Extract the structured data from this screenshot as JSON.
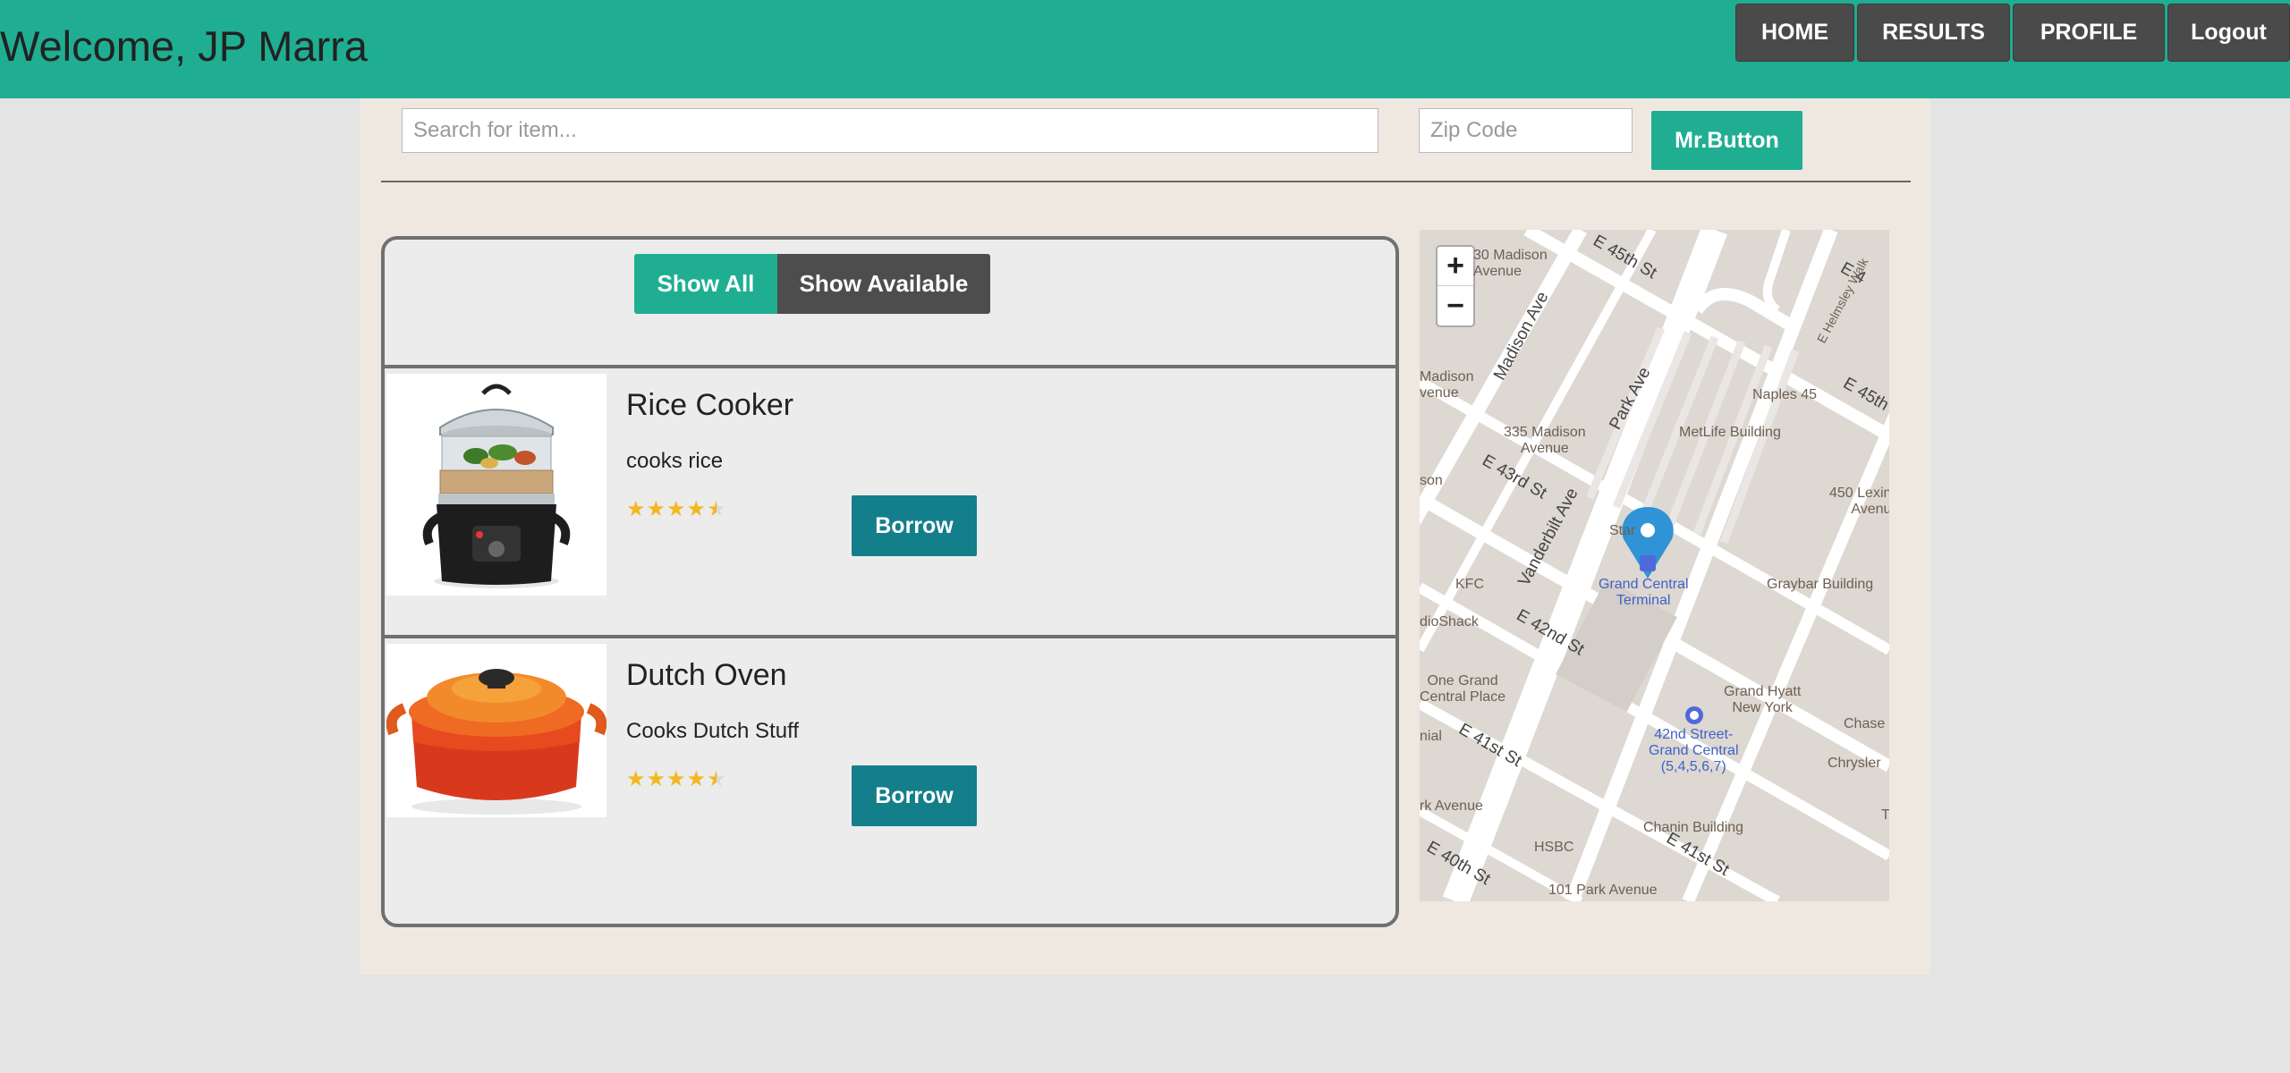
{
  "header": {
    "welcome": "Welcome, JP Marra",
    "nav": [
      {
        "label": "HOME"
      },
      {
        "label": "RESULTS"
      },
      {
        "label": "PROFILE"
      },
      {
        "label": "Logout"
      }
    ]
  },
  "search": {
    "item_placeholder": "Search for item...",
    "item_value": "",
    "zip_placeholder": "Zip Code",
    "zip_value": "",
    "button_label": "Mr.Button"
  },
  "filters": {
    "all_label": "Show All",
    "available_label": "Show Available"
  },
  "items": [
    {
      "title": "Rice Cooker",
      "description": "cooks rice",
      "rating": 4.5,
      "borrow_label": "Borrow",
      "image_icon": "rice-cooker-image"
    },
    {
      "title": "Dutch Oven",
      "description": "Cooks Dutch Stuff",
      "rating": 4.5,
      "borrow_label": "Borrow",
      "image_icon": "dutch-oven-image"
    }
  ],
  "map": {
    "zoom_in": "+",
    "zoom_out": "−",
    "labels": {
      "madison_avenue_30": "30 Madison\nAvenue",
      "e45th": "E 45th St",
      "e45th_b": "E 45th S",
      "e4": "E 4",
      "helmsley": "E Helmsley Walk",
      "madison_ave": "Madison Ave",
      "madison_avenue_w": "Madison\nvenue",
      "park_ave": "Park Ave",
      "naples": "Naples 45",
      "madison_335": "335 Madison\nAvenue",
      "metlife": "MetLife Building",
      "e43rd": "E 43rd St",
      "dson": "son",
      "lexington_450": "450 Lexin\nAvenu",
      "vanderbilt": "Vanderbilt Ave",
      "star": "Star",
      "kfc": "KFC",
      "grand_central": "Grand Central\nTerminal",
      "graybar": "Graybar Building",
      "radioshack": "dioShack",
      "e42nd": "E 42nd St",
      "one_grand": "One Grand\nCentral Place",
      "grand_hyatt": "Grand Hyatt\nNew York",
      "chase": "Chase",
      "nial": "nial",
      "e41st": "E 41st St",
      "station": "42nd Street-\nGrand Central\n(5,4,5,6,7)",
      "chrysler": "Chrysler",
      "rk_avenue": "rk Avenue",
      "chanin": "Chanin Building",
      "hsbc": "HSBC",
      "e40th": "E 40th St",
      "e41st_b": "E 41st St",
      "park_101": "101 Park Avenue",
      "t": "T"
    }
  },
  "colors": {
    "brand": "#1fae92",
    "nav_bg": "#4a4a4a",
    "borrow": "#137f8a",
    "panel": "#efe8e1"
  }
}
